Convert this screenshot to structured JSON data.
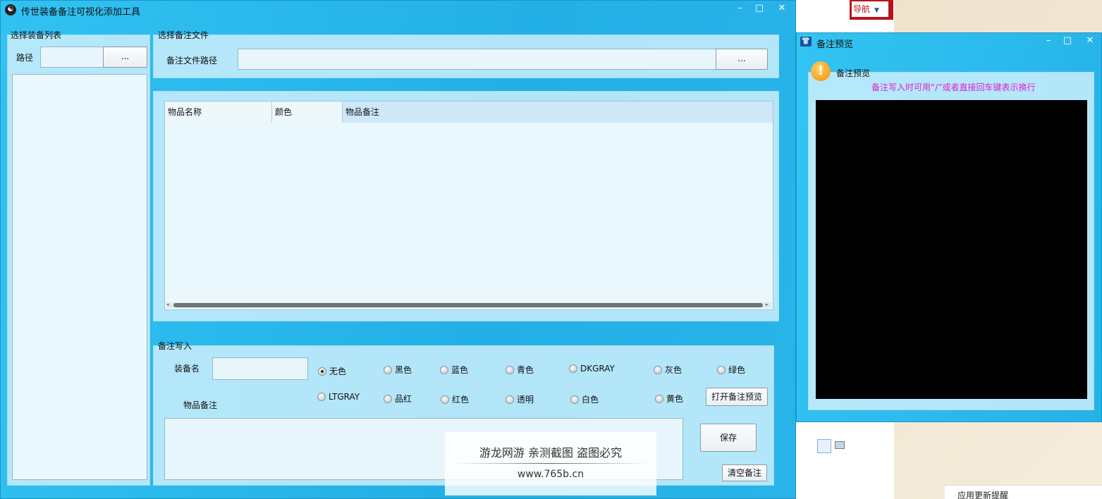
{
  "background": {
    "tab_label": "导航",
    "bottom_text": "应用更新提醒"
  },
  "main_window": {
    "title": "传世装备备注可视化添加工具",
    "controls": {
      "minimize": "–",
      "maximize": "□",
      "close": "✕"
    },
    "equipment_list": {
      "group_title": "选择装备列表",
      "path_label": "路径",
      "path_value": "",
      "browse_label": "..."
    },
    "note_file": {
      "group_title": "选择备注文件",
      "path_label": "备注文件路径",
      "path_value": "",
      "browse_label": "..."
    },
    "table": {
      "columns": [
        "物品名称",
        "颜色",
        "物品备注"
      ],
      "rows": []
    },
    "note_write": {
      "group_title": "备注写入",
      "equip_name_label": "装备名",
      "equip_name_value": "",
      "item_note_label": "物品备注",
      "item_note_value": "",
      "colors_row1": [
        "无色",
        "黑色",
        "蓝色",
        "青色",
        "DKGRAY",
        "灰色",
        "绿色"
      ],
      "colors_row2": [
        "LTGRAY",
        "品红",
        "红色",
        "透明",
        "白色",
        "黄色"
      ],
      "selected_color": "无色",
      "open_preview_label": "打开备注预览",
      "save_label": "保存",
      "clear_label": "清空备注"
    }
  },
  "preview_window": {
    "title": "备注预览",
    "controls": {
      "minimize": "–",
      "maximize": "□",
      "close": "✕"
    },
    "group_title": "备注预览",
    "hint": "备注写入时可用“/”或者直接回车键表示换行",
    "canvas_color": "#000000"
  },
  "watermark": {
    "line1": "游龙网游 亲测截图 盗图必究",
    "line2": "www.765b.cn"
  },
  "colors": {
    "window_blue": "#2bb5e8",
    "panel": "#cdeffc",
    "hint_magenta": "#e21fd1"
  }
}
